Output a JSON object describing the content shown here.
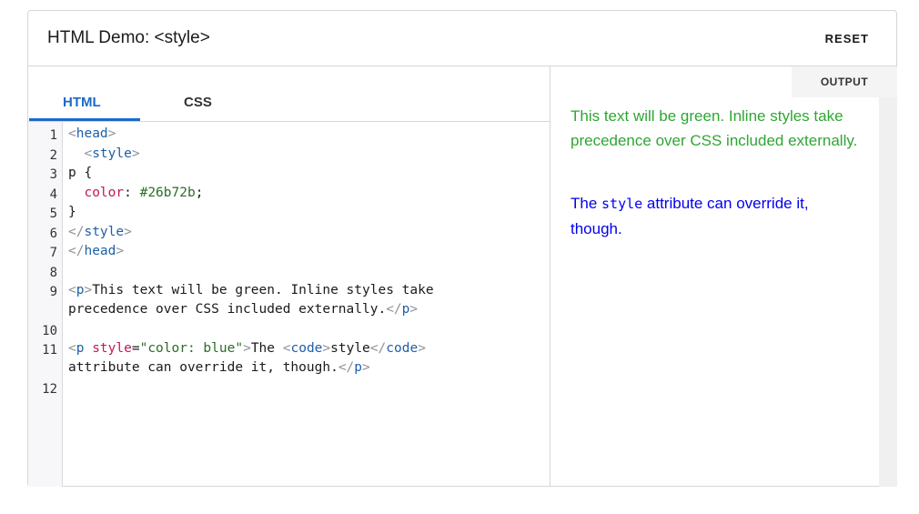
{
  "header": {
    "title": "HTML Demo: <style>",
    "reset_label": "RESET"
  },
  "tabs": [
    {
      "label": "HTML",
      "active": true
    },
    {
      "label": "CSS",
      "active": false
    }
  ],
  "editor": {
    "line_numbers": [
      "1",
      "2",
      "3",
      "4",
      "5",
      "6",
      "7",
      "8",
      "9",
      "10",
      "11",
      "12"
    ],
    "lines": {
      "l1_tag": "head",
      "l2_tag": "style",
      "l3_sel": "p {",
      "l4_prop": "color",
      "l4_val": "#26b72b",
      "l5": "}",
      "l6_tag": "style",
      "l7_tag": "head",
      "l9_tag_open": "p",
      "l9_text": "This text will be green. Inline styles take",
      "l9b_text": "precedence over CSS included externally.",
      "l9b_tag_close": "p",
      "l11_tag_open": "p",
      "l11_attr": "style",
      "l11_str": "\"color: blue\"",
      "l11_text_a": "The ",
      "l11_code_tag": "code",
      "l11_code_text": "style",
      "l11b_text": "attribute can override it, though.",
      "l11b_tag_close": "p"
    }
  },
  "output": {
    "label": "OUTPUT",
    "p1": "This text will be green. Inline styles take precedence over CSS included externally.",
    "p2_before": "The ",
    "p2_code": "style",
    "p2_after": " attribute can override it, though.",
    "p1_color": "#26b72b",
    "p2_color": "blue"
  }
}
